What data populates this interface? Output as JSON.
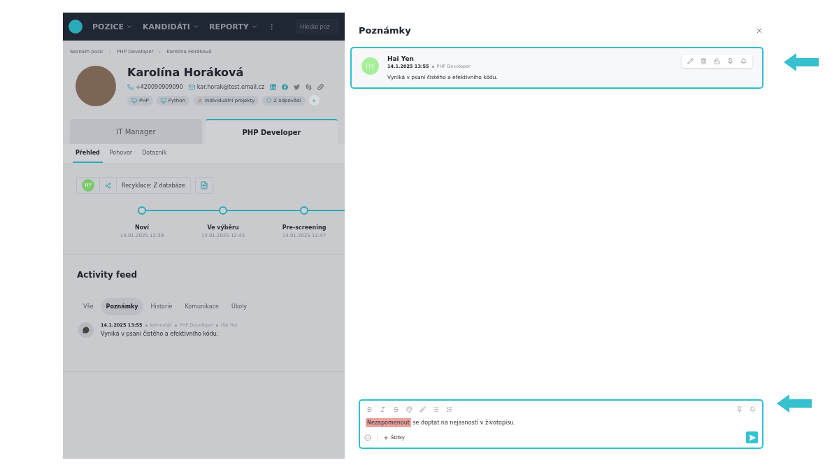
{
  "nav": {
    "menus": [
      {
        "label": "POZICE"
      },
      {
        "label": "KANDIDÁTI"
      },
      {
        "label": "REPORTY"
      }
    ],
    "search": {
      "placeholder": "Hledat poz"
    }
  },
  "breadcrumbs": [
    "Seznam pozic",
    "PHP Developer",
    "Karolína Horáková"
  ],
  "candidate": {
    "name": "Karolína Horáková",
    "phone": "+420090909090",
    "email": "kar.horak@test.email.cz",
    "tags": [
      {
        "label": "PHP",
        "kind": "skill"
      },
      {
        "label": "Python",
        "kind": "skill"
      },
      {
        "label": "Individuální projekty",
        "kind": "person"
      },
      {
        "label": "Z odpovědi",
        "kind": "source"
      }
    ]
  },
  "position_tabs": [
    {
      "label": "IT Manager",
      "selected": false
    },
    {
      "label": "PHP Developer",
      "selected": true
    }
  ],
  "sub_tabs": [
    {
      "label": "Přehled",
      "selected": true
    },
    {
      "label": "Pohovor",
      "selected": false
    },
    {
      "label": "Dotazník",
      "selected": false
    }
  ],
  "pipeline": {
    "initials": "HY",
    "source": "Recyklace: Z databáze",
    "stages": [
      {
        "name": "Noví",
        "date": "14.01.2025 12:39"
      },
      {
        "name": "Ve výběru",
        "date": "14.01.2025 12:43"
      },
      {
        "name": "Pre-screening",
        "date": "14.01.2025 12:47"
      }
    ]
  },
  "activity": {
    "title": "Activity feed",
    "filters": [
      {
        "label": "Vše",
        "selected": false
      },
      {
        "label": "Poznámky",
        "selected": true
      },
      {
        "label": "Historie",
        "selected": false
      },
      {
        "label": "Komunikace",
        "selected": false
      },
      {
        "label": "Úkoly",
        "selected": false
      }
    ],
    "items": [
      {
        "date": "14.1.2025 13:55",
        "type": "komentář",
        "position": "PHP Developer",
        "author": "Hai Yen",
        "text": "Vyniká v psaní čistého a efektivního kódu."
      }
    ]
  },
  "panel": {
    "title": "Poznámky",
    "notes": [
      {
        "author": "Hai Yen",
        "initials": "HY",
        "date": "14.1.2025 13:55",
        "position": "PHP Developer",
        "text": "Vyniká v psaní čistého a efektivního kódu."
      }
    ],
    "editor": {
      "segments": [
        {
          "text": "Nezapomenout",
          "highlighted": true
        },
        {
          "text": " se doptat na nejasnosti v životopisu.",
          "highlighted": false
        }
      ],
      "tags_label": "Štítky"
    }
  }
}
